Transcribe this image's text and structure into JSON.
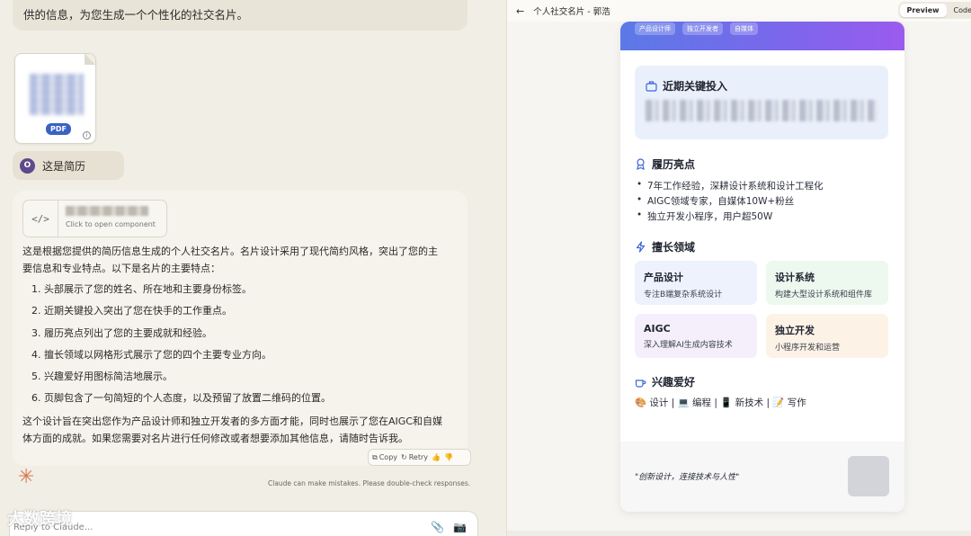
{
  "chat": {
    "prev_message_tail": "供的信息，为您生成一个个性化的社交名片。",
    "file": {
      "badge": "PDF",
      "info_icon": "info-icon"
    },
    "user_message": {
      "avatar": "O",
      "text": "这是简历"
    },
    "component": {
      "code_glyph": "</>",
      "hint": "Click to open component"
    },
    "intro": "这是根据您提供的简历信息生成的个人社交名片。名片设计采用了现代简约风格，突出了您的主要信息和专业特点。以下是名片的主要特点：",
    "points": [
      "1. 头部展示了您的姓名、所在地和主要身份标签。",
      "2. 近期关键投入突出了您在快手的工作重点。",
      "3. 履历亮点列出了您的主要成就和经验。",
      "4. 擅长领域以网格形式展示了您的四个主要专业方向。",
      "5. 兴趣爱好用图标简洁地展示。",
      "6. 页脚包含了一句简短的个人态度，以及预留了放置二维码的位置。"
    ],
    "outro": "这个设计旨在突出您作为产品设计师和独立开发者的多方面才能，同时也展示了您在AIGC和自媒体方面的成就。如果您需要对名片进行任何修改或者想要添加其他信息，请随时告诉我。",
    "actions": {
      "copy": "Copy",
      "retry": "Retry"
    },
    "disclaimer": "Claude can make mistakes. Please double-check responses.",
    "watermark": "大数跨境",
    "reply_placeholder": "Reply to Claude..."
  },
  "artifact": {
    "title": "个人社交名片 - 郭浩",
    "tabs": {
      "preview": "Preview",
      "code": "Code"
    },
    "card": {
      "tags": [
        "产品设计师",
        "独立开发者",
        "自媒体"
      ],
      "invest_title": "近期关键投入",
      "highlights_title": "履历亮点",
      "highlights": [
        "7年工作经验，深耕设计系统和设计工程化",
        "AIGC领域专家，自媒体10W+粉丝",
        "独立开发小程序，用户超50W"
      ],
      "fields_title": "擅长领域",
      "fields": [
        {
          "title": "产品设计",
          "desc": "专注B端复杂系统设计"
        },
        {
          "title": "设计系统",
          "desc": "构建大型设计系统和组件库"
        },
        {
          "title": "AIGC",
          "desc": "深入理解AI生成内容技术"
        },
        {
          "title": "独立开发",
          "desc": "小程序开发和运营"
        }
      ],
      "hobby_title": "兴趣爱好",
      "hobbies": "🎨 设计 | 💻 编程 | 📱 新技术 | 📝 写作",
      "quote": "\"创新设计，连接技术与人性\""
    }
  }
}
